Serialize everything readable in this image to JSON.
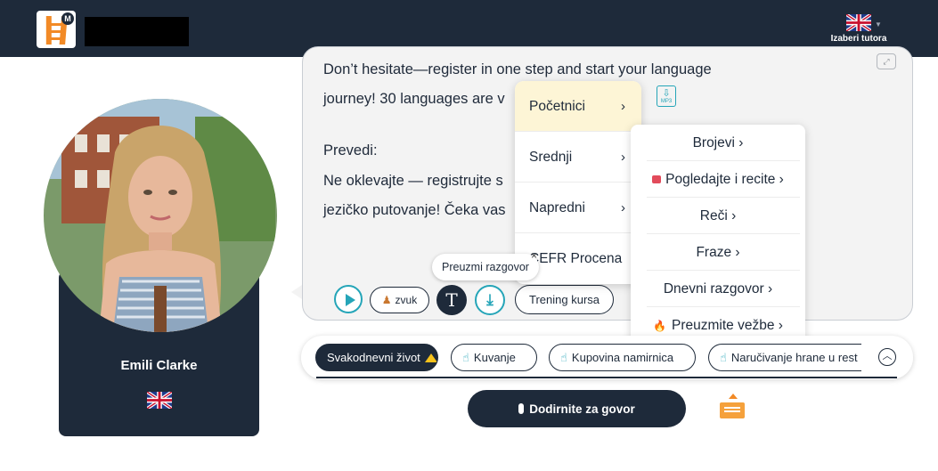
{
  "header": {
    "tutor_label": "Izaberi tutora",
    "flag_icon": "uk-flag-icon",
    "colors": {
      "bg": "#1e2a3a",
      "accent": "#f28a26"
    }
  },
  "avatar": {
    "name": "Emili Clarke",
    "flag_icon": "uk-flag-icon"
  },
  "chat": {
    "lines": [
      "Don’t hesitate—register in one step and start your language",
      "journey! 30 languages are v",
      "",
      "Prevedi:",
      "Ne oklevajte — registrujte s",
      "jezičko putovanje! Čeka vas"
    ],
    "mp3_label": "MP3"
  },
  "controls": {
    "zvuk_label": "zvuk",
    "t_label": "T",
    "trening_label": "Trening kursa",
    "tooltip": "Preuzmi razgovor",
    "tooltip_close": "×"
  },
  "menu_levels": [
    {
      "label": "Početnici",
      "active": true
    },
    {
      "label": "Srednji"
    },
    {
      "label": "Napredni"
    },
    {
      "label": "CEFR Procena"
    }
  ],
  "menu_sub": [
    {
      "label": "Brojevi"
    },
    {
      "label": "Pogledajte i recite",
      "icon": "red-book-icon"
    },
    {
      "label": "Reči"
    },
    {
      "label": "Fraze"
    },
    {
      "label": "Dnevni razgovor"
    },
    {
      "label": "Preuzmite vežbe",
      "icon": "fire-icon"
    }
  ],
  "topics": {
    "items": [
      "Svakodnevni život",
      "Kuvanje",
      "Kupovina namirnica",
      "Naručivanje hrane u rest"
    ]
  },
  "speak": {
    "label": "Dodirnite za govor"
  }
}
